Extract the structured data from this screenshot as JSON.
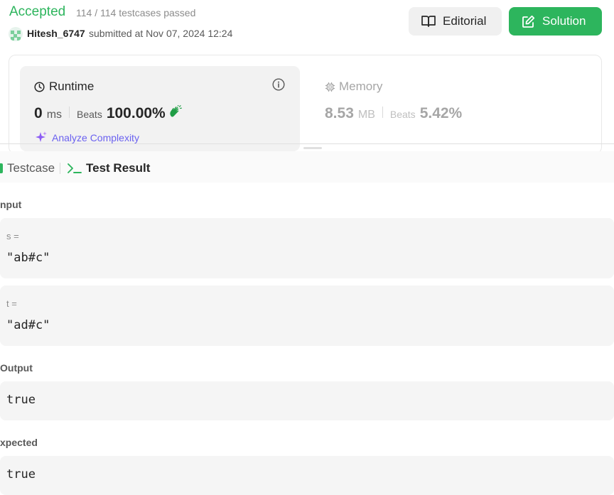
{
  "header": {
    "status": "Accepted",
    "testcases_passed": "114 / 114 testcases passed",
    "username": "Hitesh_6747",
    "submitted_at": "submitted at Nov 07, 2024 12:24",
    "buttons": {
      "editorial": "Editorial",
      "solution": "Solution"
    }
  },
  "runtime": {
    "title": "Runtime",
    "value": "0",
    "unit": "ms",
    "beats_label": "Beats",
    "beats_value": "100.00%",
    "analyze_label": "Analyze Complexity"
  },
  "memory": {
    "title": "Memory",
    "value": "8.53",
    "unit": "MB",
    "beats_label": "Beats",
    "beats_value": "5.42%"
  },
  "tabs": {
    "testcase": "Testcase",
    "test_result": "Test Result"
  },
  "result": {
    "input_label": "nput",
    "inputs": [
      {
        "name": "s =",
        "value": "\"ab#c\""
      },
      {
        "name": "t =",
        "value": "\"ad#c\""
      }
    ],
    "output_label": "Output",
    "output_value": "true",
    "expected_label": "xpected",
    "expected_value": "true"
  },
  "colors": {
    "accent_green": "#2db55d",
    "analyze_purple": "#6b62f0"
  },
  "icons": [
    "book-icon",
    "edit-icon",
    "clock-icon",
    "info-icon",
    "clap-icon",
    "sparkle-icon",
    "chip-icon",
    "terminal-icon"
  ]
}
